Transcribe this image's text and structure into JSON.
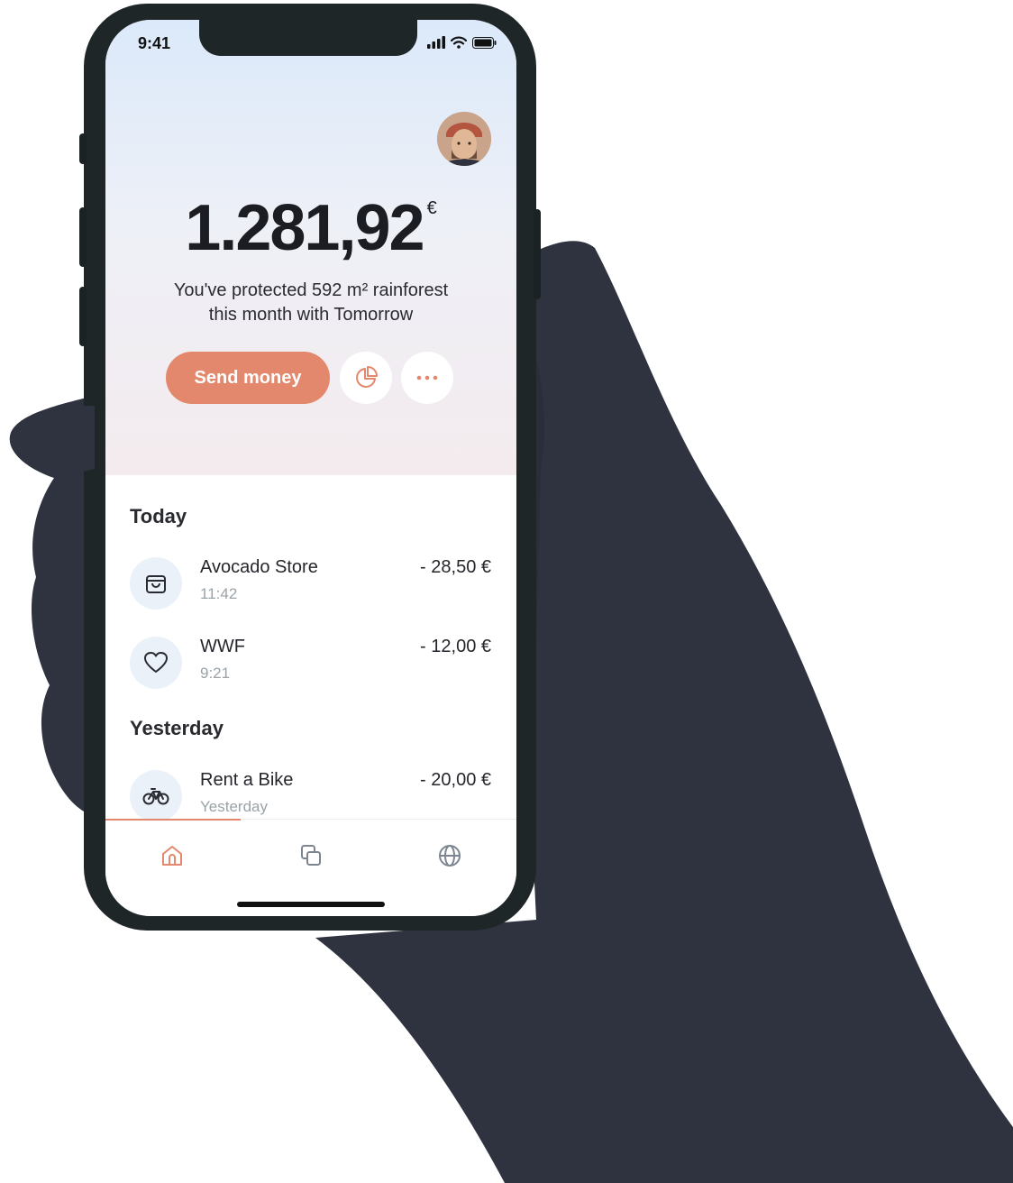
{
  "status_bar": {
    "time": "9:41"
  },
  "hero": {
    "balance": "1.281,92",
    "currency": "€",
    "subtitle_line1": "You've protected 592 m² rainforest",
    "subtitle_line2": "this month with Tomorrow",
    "send_label": "Send money"
  },
  "sections": [
    {
      "title": "Today",
      "items": [
        {
          "icon": "shopping-bag-icon",
          "name": "Avocado Store",
          "time": "11:42",
          "amount": "- 28,50 €"
        },
        {
          "icon": "heart-icon",
          "name": "WWF",
          "time": "9:21",
          "amount": "- 12,00 €"
        }
      ]
    },
    {
      "title": "Yesterday",
      "items": [
        {
          "icon": "bicycle-icon",
          "name": "Rent a Bike",
          "time": "Yesterday",
          "amount": "- 20,00 €"
        }
      ]
    }
  ],
  "tabs": [
    {
      "icon": "home-icon",
      "active": true
    },
    {
      "icon": "cards-icon",
      "active": false
    },
    {
      "icon": "globe-icon",
      "active": false
    }
  ],
  "colors": {
    "accent": "#e3886c",
    "text": "#1c1d22",
    "muted": "#9aa3a8",
    "frame": "#1f2628",
    "hand": "#2f3340"
  }
}
